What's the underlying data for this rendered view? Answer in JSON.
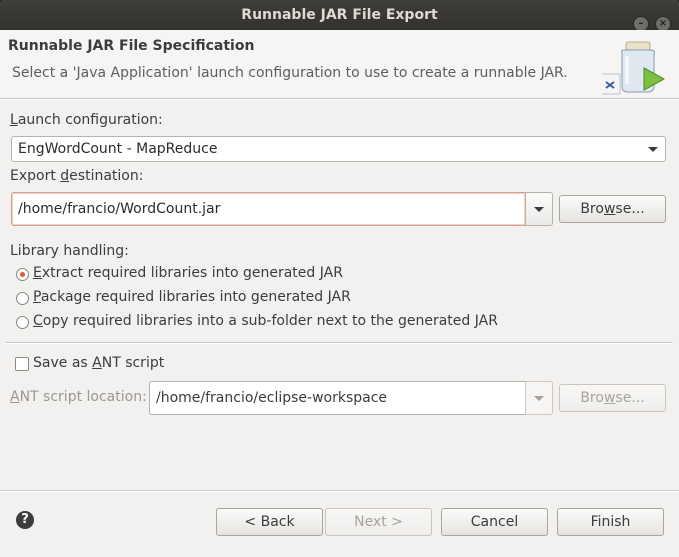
{
  "window": {
    "title": "Runnable JAR File Export"
  },
  "banner": {
    "title": "Runnable JAR File Specification",
    "description": "Select a 'Java Application' launch configuration to use to create a runnable JAR.",
    "icon": "jar-export-wizard-icon"
  },
  "launch": {
    "label_mnemonic": "L",
    "label_rest": "aunch configuration:",
    "value": "EngWordCount - MapReduce"
  },
  "export": {
    "label_pre": "Export ",
    "label_mnemonic": "d",
    "label_rest": "estination:",
    "value": "/home/francio/WordCount.jar",
    "browse_mnemonic": "w",
    "browse_pre": "Bro",
    "browse_rest": "se..."
  },
  "library": {
    "label": "Library handling:",
    "options": [
      {
        "mnemonic": "E",
        "rest": "xtract required libraries into generated JAR",
        "selected": true
      },
      {
        "mnemonic": "P",
        "rest": "ackage required libraries into generated JAR",
        "selected": false
      },
      {
        "mnemonic": "C",
        "rest": "opy required libraries into a sub-folder next to the generated JAR",
        "selected": false
      }
    ]
  },
  "ant": {
    "save_pre": "Save as ",
    "save_mnemonic": "A",
    "save_rest": "NT script",
    "save_checked": false,
    "location_mnemonic": "A",
    "location_rest": "NT script location:",
    "location_value": "/home/francio/eclipse-workspace",
    "browse_pre": "Bro",
    "browse_mnemonic": "w",
    "browse_rest": "se..."
  },
  "footer": {
    "help_icon": "help-icon",
    "back_label": "< Back",
    "next_label": "Next >",
    "cancel_label": "Cancel",
    "finish_label": "Finish"
  },
  "colors": {
    "titlebar": "#3e3d39",
    "radio_selected": "#e0553b",
    "focus_border": "#d4a08a"
  }
}
